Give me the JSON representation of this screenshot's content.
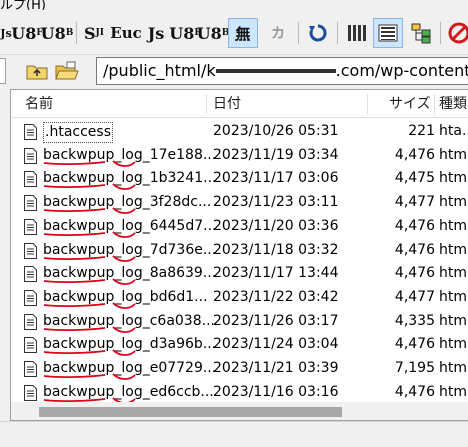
{
  "menu": {
    "partial_label": "ルプ(H)"
  },
  "toolbar": {
    "buttons": [
      {
        "label": "Js",
        "name": "jis-button"
      },
      {
        "label": "U8",
        "name": "utf8-button"
      },
      {
        "label": "U8",
        "name": "utf8-bom-button"
      },
      {
        "label": "S",
        "name": "sjis-button"
      },
      {
        "label": "Euc",
        "name": "euc-button"
      },
      {
        "label": "Js",
        "name": "jis2-button"
      },
      {
        "label": "U8",
        "name": "utf8-2-button"
      },
      {
        "label": "U8",
        "name": "utf8-bom-2-button"
      },
      {
        "label": "無",
        "name": "no-conversion-button"
      },
      {
        "label": "カ",
        "name": "kana-button"
      }
    ]
  },
  "address": {
    "path_prefix": "/public_html/k",
    "path_suffix": ".com/wp-content/up"
  },
  "columns": {
    "name": "名前",
    "date": "日付",
    "size": "サイズ",
    "type": "種類"
  },
  "files": [
    {
      "name": ".htaccess",
      "date": "2023/10/26 05:31",
      "size": "221",
      "type": "hta..."
    },
    {
      "name": "backwpup_log_17e188...",
      "date": "2023/11/19 03:34",
      "size": "4,476",
      "type": "html"
    },
    {
      "name": "backwpup_log_1b3241...",
      "date": "2023/11/17 03:06",
      "size": "4,475",
      "type": "html"
    },
    {
      "name": "backwpup_log_3f28dc...",
      "date": "2023/11/23 03:11",
      "size": "4,477",
      "type": "html"
    },
    {
      "name": "backwpup_log_6445d7...",
      "date": "2023/11/20 03:36",
      "size": "4,476",
      "type": "html"
    },
    {
      "name": "backwpup_log_7d736e...",
      "date": "2023/11/18 03:32",
      "size": "4,476",
      "type": "html"
    },
    {
      "name": "backwpup_log_8a8639...",
      "date": "2023/11/17 13:44",
      "size": "4,476",
      "type": "html"
    },
    {
      "name": "backwpup_log_bd6d1...",
      "date": "2023/11/22 03:42",
      "size": "4,477",
      "type": "html"
    },
    {
      "name": "backwpup_log_c6a038...",
      "date": "2023/11/26 03:17",
      "size": "4,335",
      "type": "html"
    },
    {
      "name": "backwpup_log_d3a96b...",
      "date": "2023/11/24 03:04",
      "size": "4,476",
      "type": "html"
    },
    {
      "name": "backwpup_log_e07729...",
      "date": "2023/11/21 03:39",
      "size": "7,195",
      "type": "html"
    },
    {
      "name": "backwpup_log_ed6ccb...",
      "date": "2023/11/16 03:16",
      "size": "4,476",
      "type": "html"
    }
  ],
  "colors": {
    "selected_button": "#cde6ff",
    "annotation_red": "#e0001b"
  }
}
